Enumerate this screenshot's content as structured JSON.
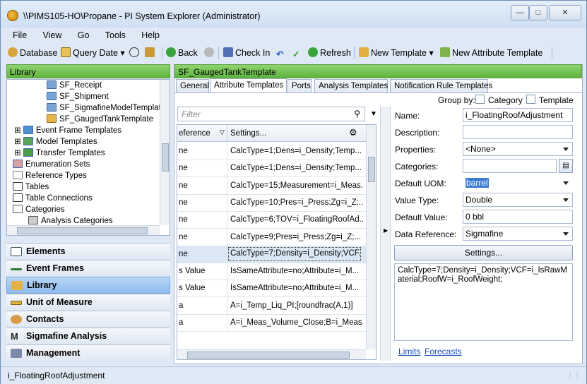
{
  "window": {
    "title": "\\\\PIMS105-HO\\Propane - PI System Explorer (Administrator)"
  },
  "menu": [
    "File",
    "View",
    "Go",
    "Tools",
    "Help"
  ],
  "toolbar": {
    "database": "Database",
    "query_date": "Query Date",
    "back": "Back",
    "check_in": "Check In",
    "refresh": "Refresh",
    "new_template": "New Template",
    "new_attribute_template": "New Attribute Template"
  },
  "library": {
    "header": "Library",
    "tree": [
      "SF_Receipt",
      "SF_Shipment",
      "SF_SigmafineModelTemplate",
      "SF_GaugedTankTemplate",
      "Event Frame Templates",
      "Model Templates",
      "Transfer Templates",
      "Enumeration Sets",
      "Reference Types",
      "Tables",
      "Table Connections",
      "Categories",
      "Analysis Categories"
    ]
  },
  "nav": [
    "Elements",
    "Event Frames",
    "Library",
    "Unit of Measure",
    "Contacts",
    "Sigmafine Analysis",
    "Management"
  ],
  "template": {
    "header": "SF_GaugedTankTemplate",
    "tabs": [
      "General",
      "Attribute Templates",
      "Ports",
      "Analysis Templates",
      "Notification Rule Templates"
    ],
    "group_by": "Group by:",
    "category_cb": "Category",
    "template_cb": "Template",
    "filter_placeholder": "Filter",
    "col_reference": "eference",
    "col_settings": "Settings...",
    "rows": [
      {
        "ref": "ne",
        "settings": "CalcType=1;Dens=i_Density;Temp..."
      },
      {
        "ref": "ne",
        "settings": "CalcType=1;Dens=i_Density;Temp..."
      },
      {
        "ref": "ne",
        "settings": "CalcType=15;Measurement=i_Meas..."
      },
      {
        "ref": "ne",
        "settings": "CalcType=10;Pres=i_Press;Zg=i_Z;..."
      },
      {
        "ref": "ne",
        "settings": "CalcType=6;TOV=i_FloatingRoofAd..."
      },
      {
        "ref": "ne",
        "settings": "CalcType=9;Pres=i_Press;Zg=i_Z;..."
      },
      {
        "ref": "ne",
        "settings": "CalcType=7;Density=i_Density;VCF..."
      },
      {
        "ref": "s Value",
        "settings": "IsSameAttribute=no;Attribute=i_M..."
      },
      {
        "ref": "s Value",
        "settings": "IsSameAttribute=no;Attribute=i_M..."
      },
      {
        "ref": "a",
        "settings": "A=i_Temp_Liq_PI;[roundfrac(A,1)]"
      },
      {
        "ref": "a",
        "settings": "A=i_Meas_Volume_Close;B=i_Meas..."
      }
    ]
  },
  "details": {
    "name_lbl": "Name:",
    "name_val": "i_FloatingRoofAdjustment",
    "desc_lbl": "Description:",
    "desc_val": "",
    "props_lbl": "Properties:",
    "props_val": "<None>",
    "cats_lbl": "Categories:",
    "cats_val": "",
    "uom_lbl": "Default UOM:",
    "uom_val": "barrel",
    "vtype_lbl": "Value Type:",
    "vtype_val": "Double",
    "dval_lbl": "Default Value:",
    "dval_val": "0 bbl",
    "dref_lbl": "Data Reference:",
    "dref_val": "Sigmafine",
    "settings_btn": "Settings...",
    "config": "CalcType=7;Density=i_Density;VCF=i_IsRawMaterial;RoofW=i_RoofWeight;",
    "limits": "Limits",
    "forecasts": "Forecasts"
  },
  "status": "i_FloatingRoofAdjustment",
  "colors": {
    "header_green": "#6fc04f",
    "selection_blue": "#9cc3ee"
  }
}
